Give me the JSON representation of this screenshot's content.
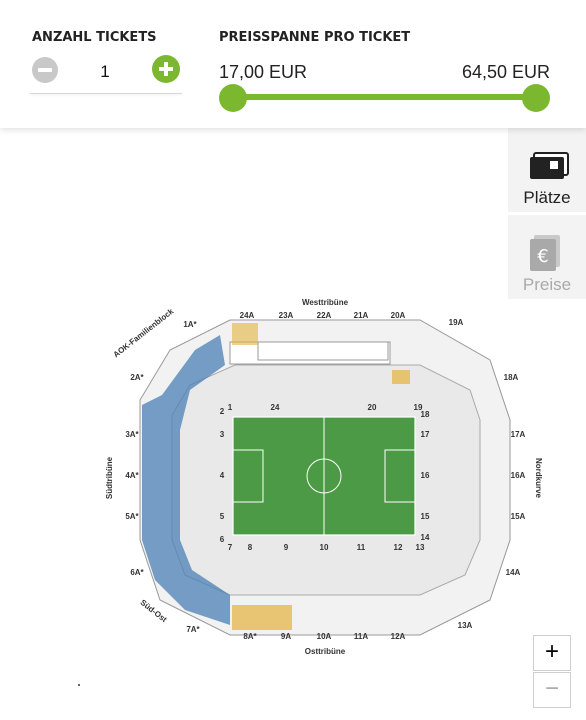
{
  "filter": {
    "tickets_label": "ANZAHL TICKETS",
    "quantity": "1",
    "price_label": "PREISSPANNE PRO TICKET",
    "price_min": "17,00 EUR",
    "price_max": "64,50 EUR",
    "range_fraction": [
      0.0,
      1.0
    ]
  },
  "side_tabs": [
    {
      "label": "Plätze",
      "icon": "tickets-icon",
      "active": true
    },
    {
      "label": "Preise",
      "icon": "euro-icon",
      "active": false
    }
  ],
  "zoom": {
    "in": "+",
    "out": "−"
  },
  "stadium": {
    "stands": {
      "west": "Westtribüne",
      "ost": "Osttribüne",
      "sued": "Südtribüne",
      "nord": "Nordkurve",
      "familie": "AOK-Familienblock",
      "suedost": "Süd-Ost"
    },
    "blocks_top": [
      "24A",
      "23A",
      "22A",
      "21A",
      "20A"
    ],
    "blocks_bottom": [
      "8A*",
      "9A",
      "10A",
      "11A",
      "12A"
    ],
    "blocks_left": [
      "1A*",
      "2A*",
      "3A*",
      "4A*",
      "5A*",
      "6A*",
      "7A*"
    ],
    "blocks_right": [
      "19A",
      "18A",
      "17A",
      "16A",
      "15A",
      "14A",
      "13A"
    ],
    "inner_top": [
      "1",
      "24",
      "20",
      "19"
    ],
    "inner_bottom": [
      "7",
      "8",
      "9",
      "10",
      "11",
      "12",
      "13"
    ],
    "inner_left": [
      "2",
      "3",
      "4",
      "5",
      "6"
    ],
    "inner_right": [
      "18",
      "17",
      "16",
      "15",
      "14"
    ],
    "colors": {
      "pitch": "#4c9a45",
      "seats_family": "#4a7fb5",
      "seats_available": "#e3b23c",
      "accent": "#7cb82f"
    }
  }
}
